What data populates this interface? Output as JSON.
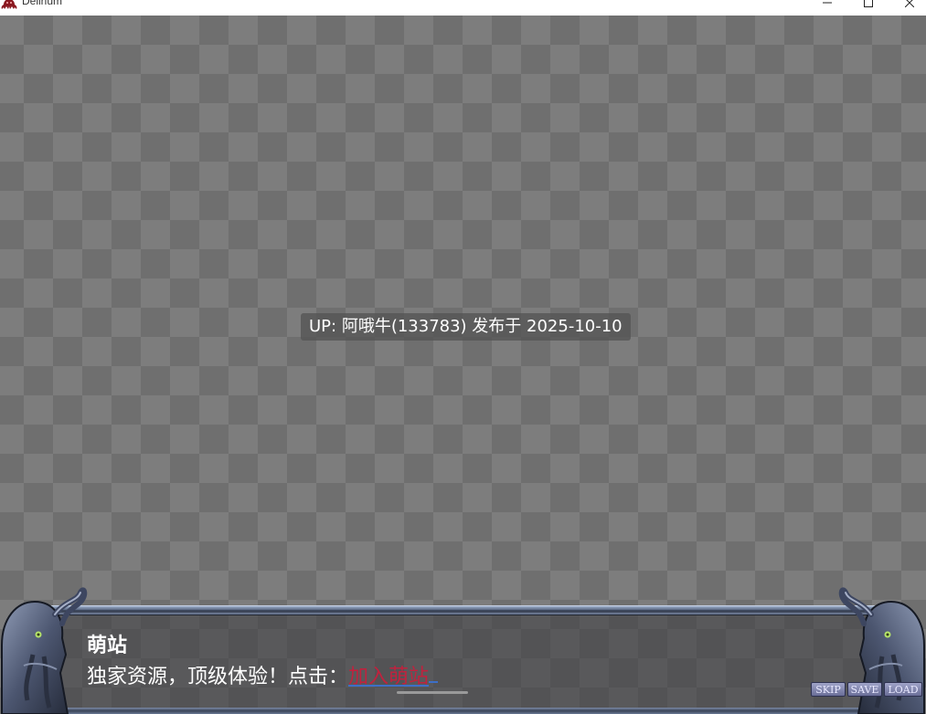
{
  "window": {
    "title": "Delirium",
    "icon": "tentacle-logo-icon",
    "controls": [
      "minimize-icon",
      "maximize-icon",
      "close-icon"
    ]
  },
  "game": {
    "watermark": "UP: 阿哦牛(133783) 发布于 2025-10-10"
  },
  "dialogue": {
    "speaker": "萌站",
    "message_prefix": "独家资源，顶级体验！点击：",
    "link_text": "加入萌站"
  },
  "quick_buttons": {
    "skip": "SKIP",
    "save": "SAVE",
    "load": "LOAD"
  },
  "colors": {
    "checker_light": "#7d7d7d",
    "checker_dark": "#6f6f6f",
    "link": "#c0223e",
    "link_underline": "#3d6fc7",
    "frame_steel": "#56637d",
    "button_violet": "#8185ae"
  }
}
